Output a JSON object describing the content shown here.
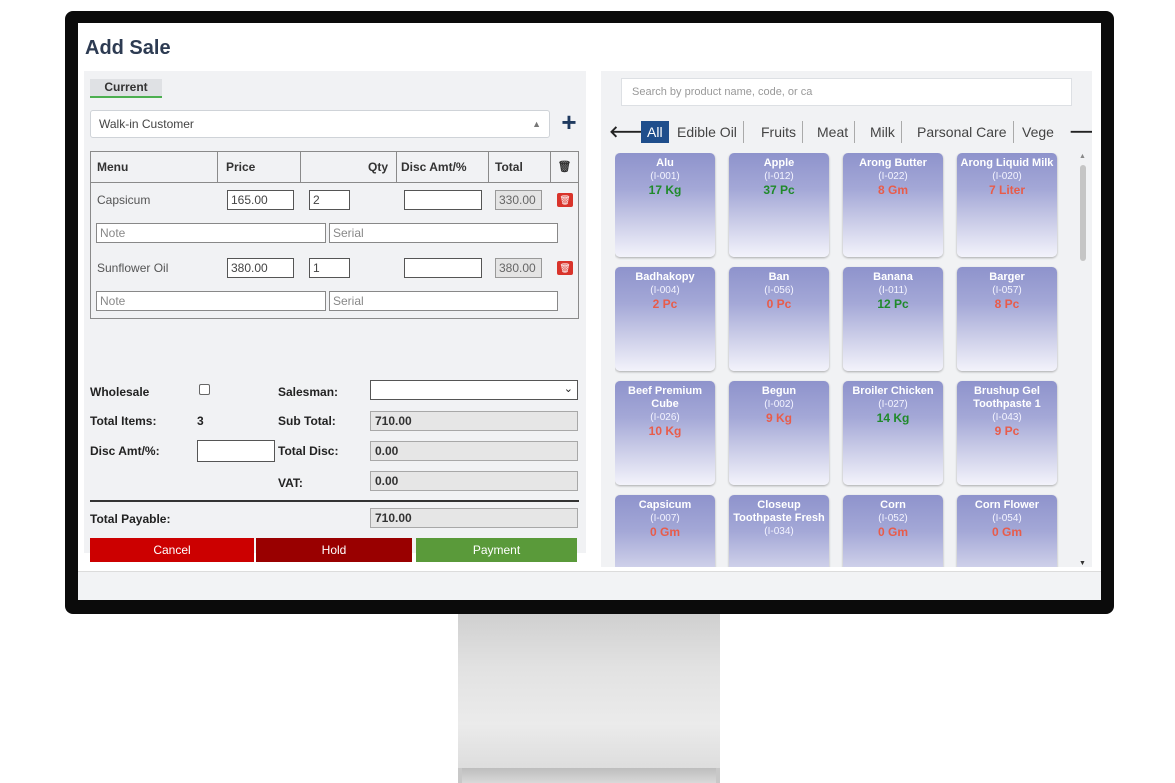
{
  "page_title": "Add Sale",
  "tab_current": "Current",
  "customer": {
    "selected": "Walk-in Customer"
  },
  "add_icon": "plus-icon",
  "cart": {
    "headers": {
      "menu": "Menu",
      "price": "Price",
      "qty": "Qty",
      "disc": "Disc Amt/%",
      "total": "Total"
    },
    "rows": [
      {
        "name": "Capsicum",
        "price": "165.00",
        "qty": "2",
        "disc": "",
        "total": "330.00",
        "note_placeholder": "Note",
        "serial_placeholder": "Serial"
      },
      {
        "name": "Sunflower Oil",
        "price": "380.00",
        "qty": "1",
        "disc": "",
        "total": "380.00",
        "note_placeholder": "Note",
        "serial_placeholder": "Serial"
      }
    ]
  },
  "summary": {
    "wholesale_label": "Wholesale",
    "salesman_label": "Salesman:",
    "salesman_value": "",
    "total_items_label": "Total Items:",
    "total_items": "3",
    "subtotal_label": "Sub Total:",
    "subtotal": "710.00",
    "disc_label": "Disc Amt/%:",
    "disc_value": "",
    "total_disc_label": "Total Disc:",
    "total_disc": "0.00",
    "vat_label": "VAT:",
    "vat": "0.00",
    "payable_label": "Total Payable:",
    "payable": "710.00"
  },
  "buttons": {
    "cancel": "Cancel",
    "hold": "Hold",
    "payment": "Payment"
  },
  "colors": {
    "cancel": "#cc0000",
    "hold": "#990000",
    "payment": "#5a9a3a",
    "active_category": "#1f4e8c"
  },
  "search": {
    "placeholder": "Search by product name, code, or ca"
  },
  "categories": [
    "All",
    "Edible Oil",
    "Fruits",
    "Meat",
    "Milk",
    "Parsonal Care",
    "Vege"
  ],
  "products": [
    {
      "name": "Alu",
      "code": "(I-001)",
      "stock": "17 Kg",
      "status": "ok"
    },
    {
      "name": "Apple",
      "code": "(I-012)",
      "stock": "37 Pc",
      "status": "ok"
    },
    {
      "name": "Arong Butter",
      "code": "(I-022)",
      "stock": "8 Gm",
      "status": "low"
    },
    {
      "name": "Arong Liquid Milk",
      "code": "(I-020)",
      "stock": "7 Liter",
      "status": "low"
    },
    {
      "name": "Badhakopy",
      "code": "(I-004)",
      "stock": "2 Pc",
      "status": "low"
    },
    {
      "name": "Ban",
      "code": "(I-056)",
      "stock": "0 Pc",
      "status": "low"
    },
    {
      "name": "Banana",
      "code": "(I-011)",
      "stock": "12 Pc",
      "status": "ok"
    },
    {
      "name": "Barger",
      "code": "(I-057)",
      "stock": "8 Pc",
      "status": "low"
    },
    {
      "name": "Beef Premium Cube",
      "code": "(I-026)",
      "stock": "10 Kg",
      "status": "low"
    },
    {
      "name": "Begun",
      "code": "(I-002)",
      "stock": "9 Kg",
      "status": "low"
    },
    {
      "name": "Broiler Chicken",
      "code": "(I-027)",
      "stock": "14 Kg",
      "status": "ok"
    },
    {
      "name": "Brushup Gel Toothpaste 1",
      "code": "(I-043)",
      "stock": "9 Pc",
      "status": "low"
    },
    {
      "name": "Capsicum",
      "code": "(I-007)",
      "stock": "0 Gm",
      "status": "low"
    },
    {
      "name": "Closeup Toothpaste Fresh",
      "code": "(I-034)",
      "stock": "",
      "status": "low"
    },
    {
      "name": "Corn",
      "code": "(I-052)",
      "stock": "0 Gm",
      "status": "low"
    },
    {
      "name": "Corn Flower",
      "code": "(I-054)",
      "stock": "0 Gm",
      "status": "low"
    }
  ]
}
